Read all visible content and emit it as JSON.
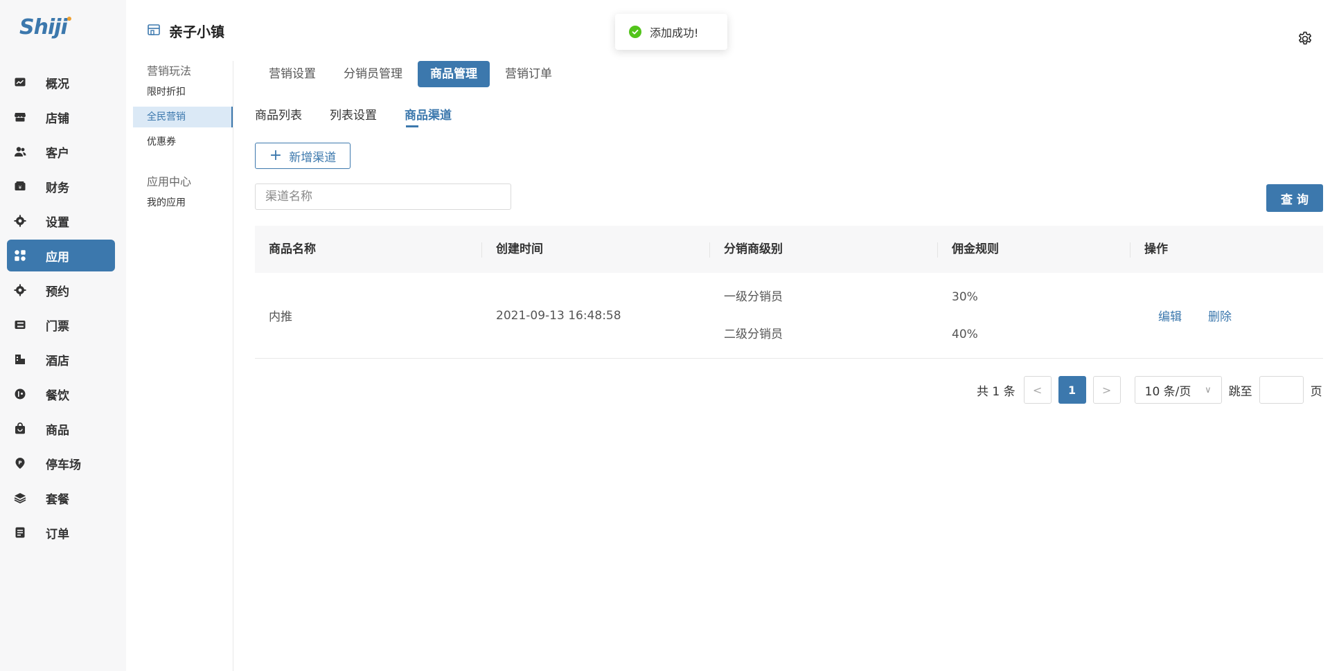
{
  "app": {
    "logo_text": "Shiji"
  },
  "sidebar": {
    "items": [
      {
        "label": "概况",
        "icon": "chart-icon"
      },
      {
        "label": "店铺",
        "icon": "store-icon"
      },
      {
        "label": "客户",
        "icon": "users-icon"
      },
      {
        "label": "财务",
        "icon": "wallet-icon"
      },
      {
        "label": "设置",
        "icon": "gear-icon"
      },
      {
        "label": "应用",
        "icon": "apps-icon",
        "active": true
      },
      {
        "label": "预约",
        "icon": "gear-icon"
      },
      {
        "label": "门票",
        "icon": "ticket-icon"
      },
      {
        "label": "酒店",
        "icon": "hotel-icon"
      },
      {
        "label": "餐饮",
        "icon": "dining-icon"
      },
      {
        "label": "商品",
        "icon": "bag-icon"
      },
      {
        "label": "停车场",
        "icon": "parking-icon"
      },
      {
        "label": "套餐",
        "icon": "layers-icon"
      },
      {
        "label": "订单",
        "icon": "order-icon"
      }
    ]
  },
  "store": {
    "title": "亲子小镇"
  },
  "subnav": {
    "group1": "营销玩法",
    "item_discount": "限时折扣",
    "item_all_marketing": "全民营销",
    "item_coupon": "优惠券",
    "group2": "应用中心",
    "item_my_apps": "我的应用"
  },
  "tabs": {
    "marketing_settings": "营销设置",
    "distributor_mgmt": "分销员管理",
    "product_mgmt": "商品管理",
    "marketing_orders": "营销订单"
  },
  "subtabs": {
    "product_list": "商品列表",
    "list_settings": "列表设置",
    "product_channels": "商品渠道"
  },
  "toolbar": {
    "add_channel": "新增渠道",
    "search_placeholder": "渠道名称",
    "query": "查询"
  },
  "table": {
    "headers": [
      "商品名称",
      "创建时间",
      "分销商级别",
      "佣金规则",
      "操作"
    ],
    "rows": [
      {
        "name": "内推",
        "created": "2021-09-13 16:48:58",
        "levels": [
          "一级分销员",
          "二级分销员"
        ],
        "rules": [
          "30%",
          "40%"
        ],
        "edit": "编辑",
        "delete": "删除"
      }
    ]
  },
  "pagination": {
    "total": "共 1 条",
    "prev": "<",
    "current": "1",
    "next": ">",
    "page_size": "10 条/页",
    "jump_label": "跳至",
    "jump_unit": "页"
  },
  "toast": {
    "message": "添加成功!"
  },
  "colors": {
    "primary": "#3c78ad",
    "success": "#52c41a"
  }
}
